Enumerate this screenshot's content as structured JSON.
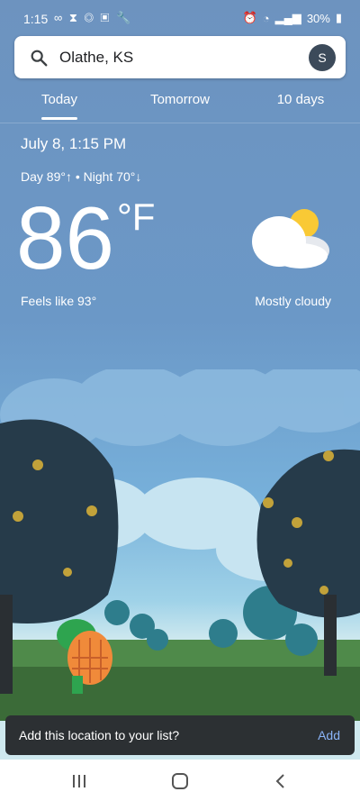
{
  "status_bar": {
    "time": "1:15",
    "battery": "30%"
  },
  "search": {
    "location": "Olathe, KS",
    "avatar_letter": "S"
  },
  "tabs": [
    {
      "label": "Today"
    },
    {
      "label": "Tomorrow"
    },
    {
      "label": "10 days"
    }
  ],
  "weather": {
    "datetime": "July 8, 1:15 PM",
    "day_night": "Day 89°↑ • Night 70°↓",
    "temperature": "86",
    "unit": "°F",
    "feels_like": "Feels like 93°",
    "condition": "Mostly cloudy"
  },
  "toast": {
    "message": "Add this location to your list?",
    "action": "Add"
  },
  "colors": {
    "accent": "#8ab4f8",
    "toast_bg": "#2c3033"
  }
}
